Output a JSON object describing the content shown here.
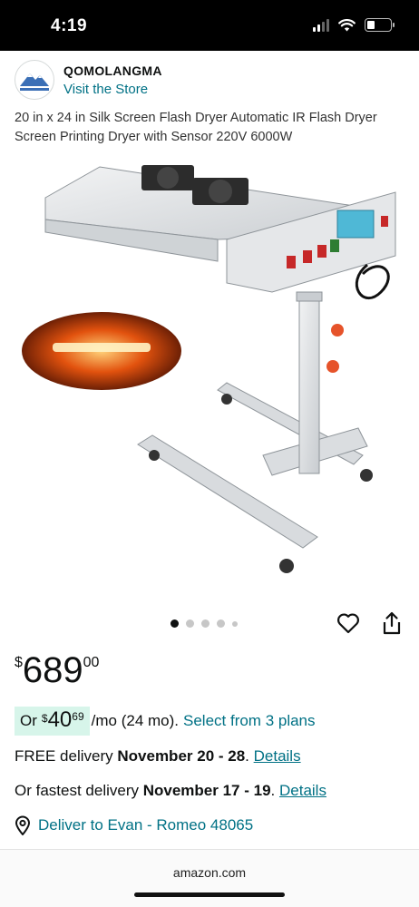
{
  "status_bar": {
    "time": "4:19"
  },
  "store": {
    "name": "QOMOLANGMA",
    "link": "Visit the Store",
    "logo_text": "QOMOLANGMA"
  },
  "product": {
    "title": "20 in x 24 in Silk Screen Flash Dryer Automatic IR Flash Dryer Screen Printing Dryer with Sensor 220V 6000W",
    "image_count": 5,
    "active_image": 1
  },
  "price": {
    "symbol": "$",
    "whole": "689",
    "fraction": "00"
  },
  "monthly": {
    "prefix": "Or",
    "symbol": "$",
    "whole": "40",
    "fraction": "69",
    "suffix": "/mo (24 mo).",
    "plans_link": "Select from 3 plans"
  },
  "delivery_free": {
    "text": "FREE delivery",
    "dates": "November 20 - 28",
    "link": "Details"
  },
  "delivery_fast": {
    "text": "Or fastest delivery",
    "dates": "November 17 - 19",
    "link": "Details"
  },
  "deliver_to": {
    "text": "Deliver to Evan - Romeo 48065"
  },
  "footer": {
    "domain": "amazon.com"
  },
  "colors": {
    "link": "#007185",
    "monthly_highlight": "#d7f5ea",
    "text": "#0f1111"
  }
}
